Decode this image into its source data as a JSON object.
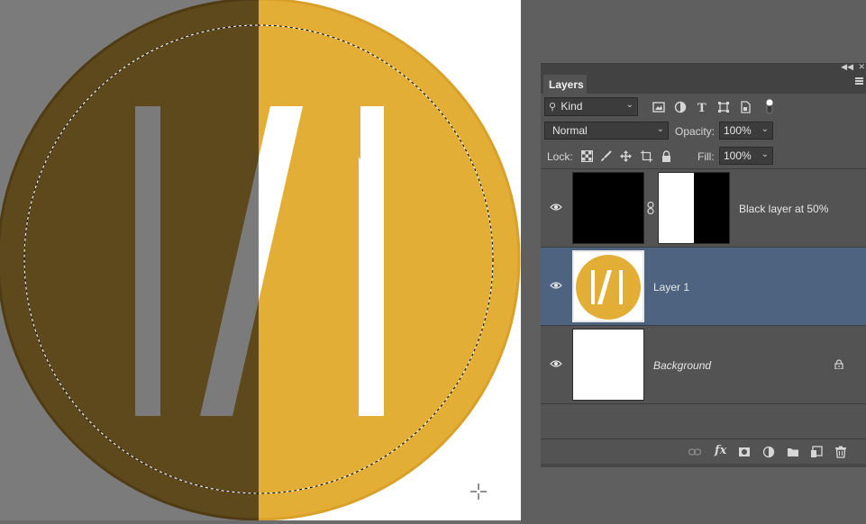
{
  "panel": {
    "tab_label": "Layers",
    "collapse_icon": "double-chevron-right-icon",
    "close_icon": "close-icon",
    "menu_icon": "hamburger-menu-icon"
  },
  "filter": {
    "kind_label": "Kind",
    "kind_icon": "search-icon",
    "icons": [
      "pixel-filter-icon",
      "adjustment-filter-icon",
      "type-filter-icon",
      "shape-filter-icon",
      "smart-object-filter-icon",
      "filter-toggle-icon"
    ]
  },
  "blend": {
    "mode": "Normal",
    "opacity_label": "Opacity:",
    "opacity_value": "100%",
    "fill_label": "Fill:",
    "fill_value": "100%"
  },
  "lock": {
    "label": "Lock:",
    "icons": [
      "lock-transparent-pixels-icon",
      "lock-image-pixels-icon",
      "lock-position-icon",
      "lock-artboard-icon",
      "lock-all-icon"
    ]
  },
  "layers": [
    {
      "name": "Black layer at 50%",
      "visible": true,
      "selected": false,
      "italic": false,
      "has_mask": true
    },
    {
      "name": "Layer 1",
      "visible": true,
      "selected": true,
      "italic": false,
      "has_mask": false
    },
    {
      "name": "Background",
      "visible": true,
      "selected": false,
      "italic": true,
      "locked": true
    }
  ],
  "footer": {
    "icons": [
      "link-layers-icon",
      "fx-icon",
      "add-mask-icon",
      "adjustment-layer-icon",
      "new-group-icon",
      "new-layer-icon",
      "trash-icon"
    ],
    "fx_text": "fx"
  },
  "colors": {
    "gold": "#e3ae36",
    "dark_gold": "#5e491c",
    "selected_row": "#4d6380",
    "panel_bg": "#535353"
  }
}
